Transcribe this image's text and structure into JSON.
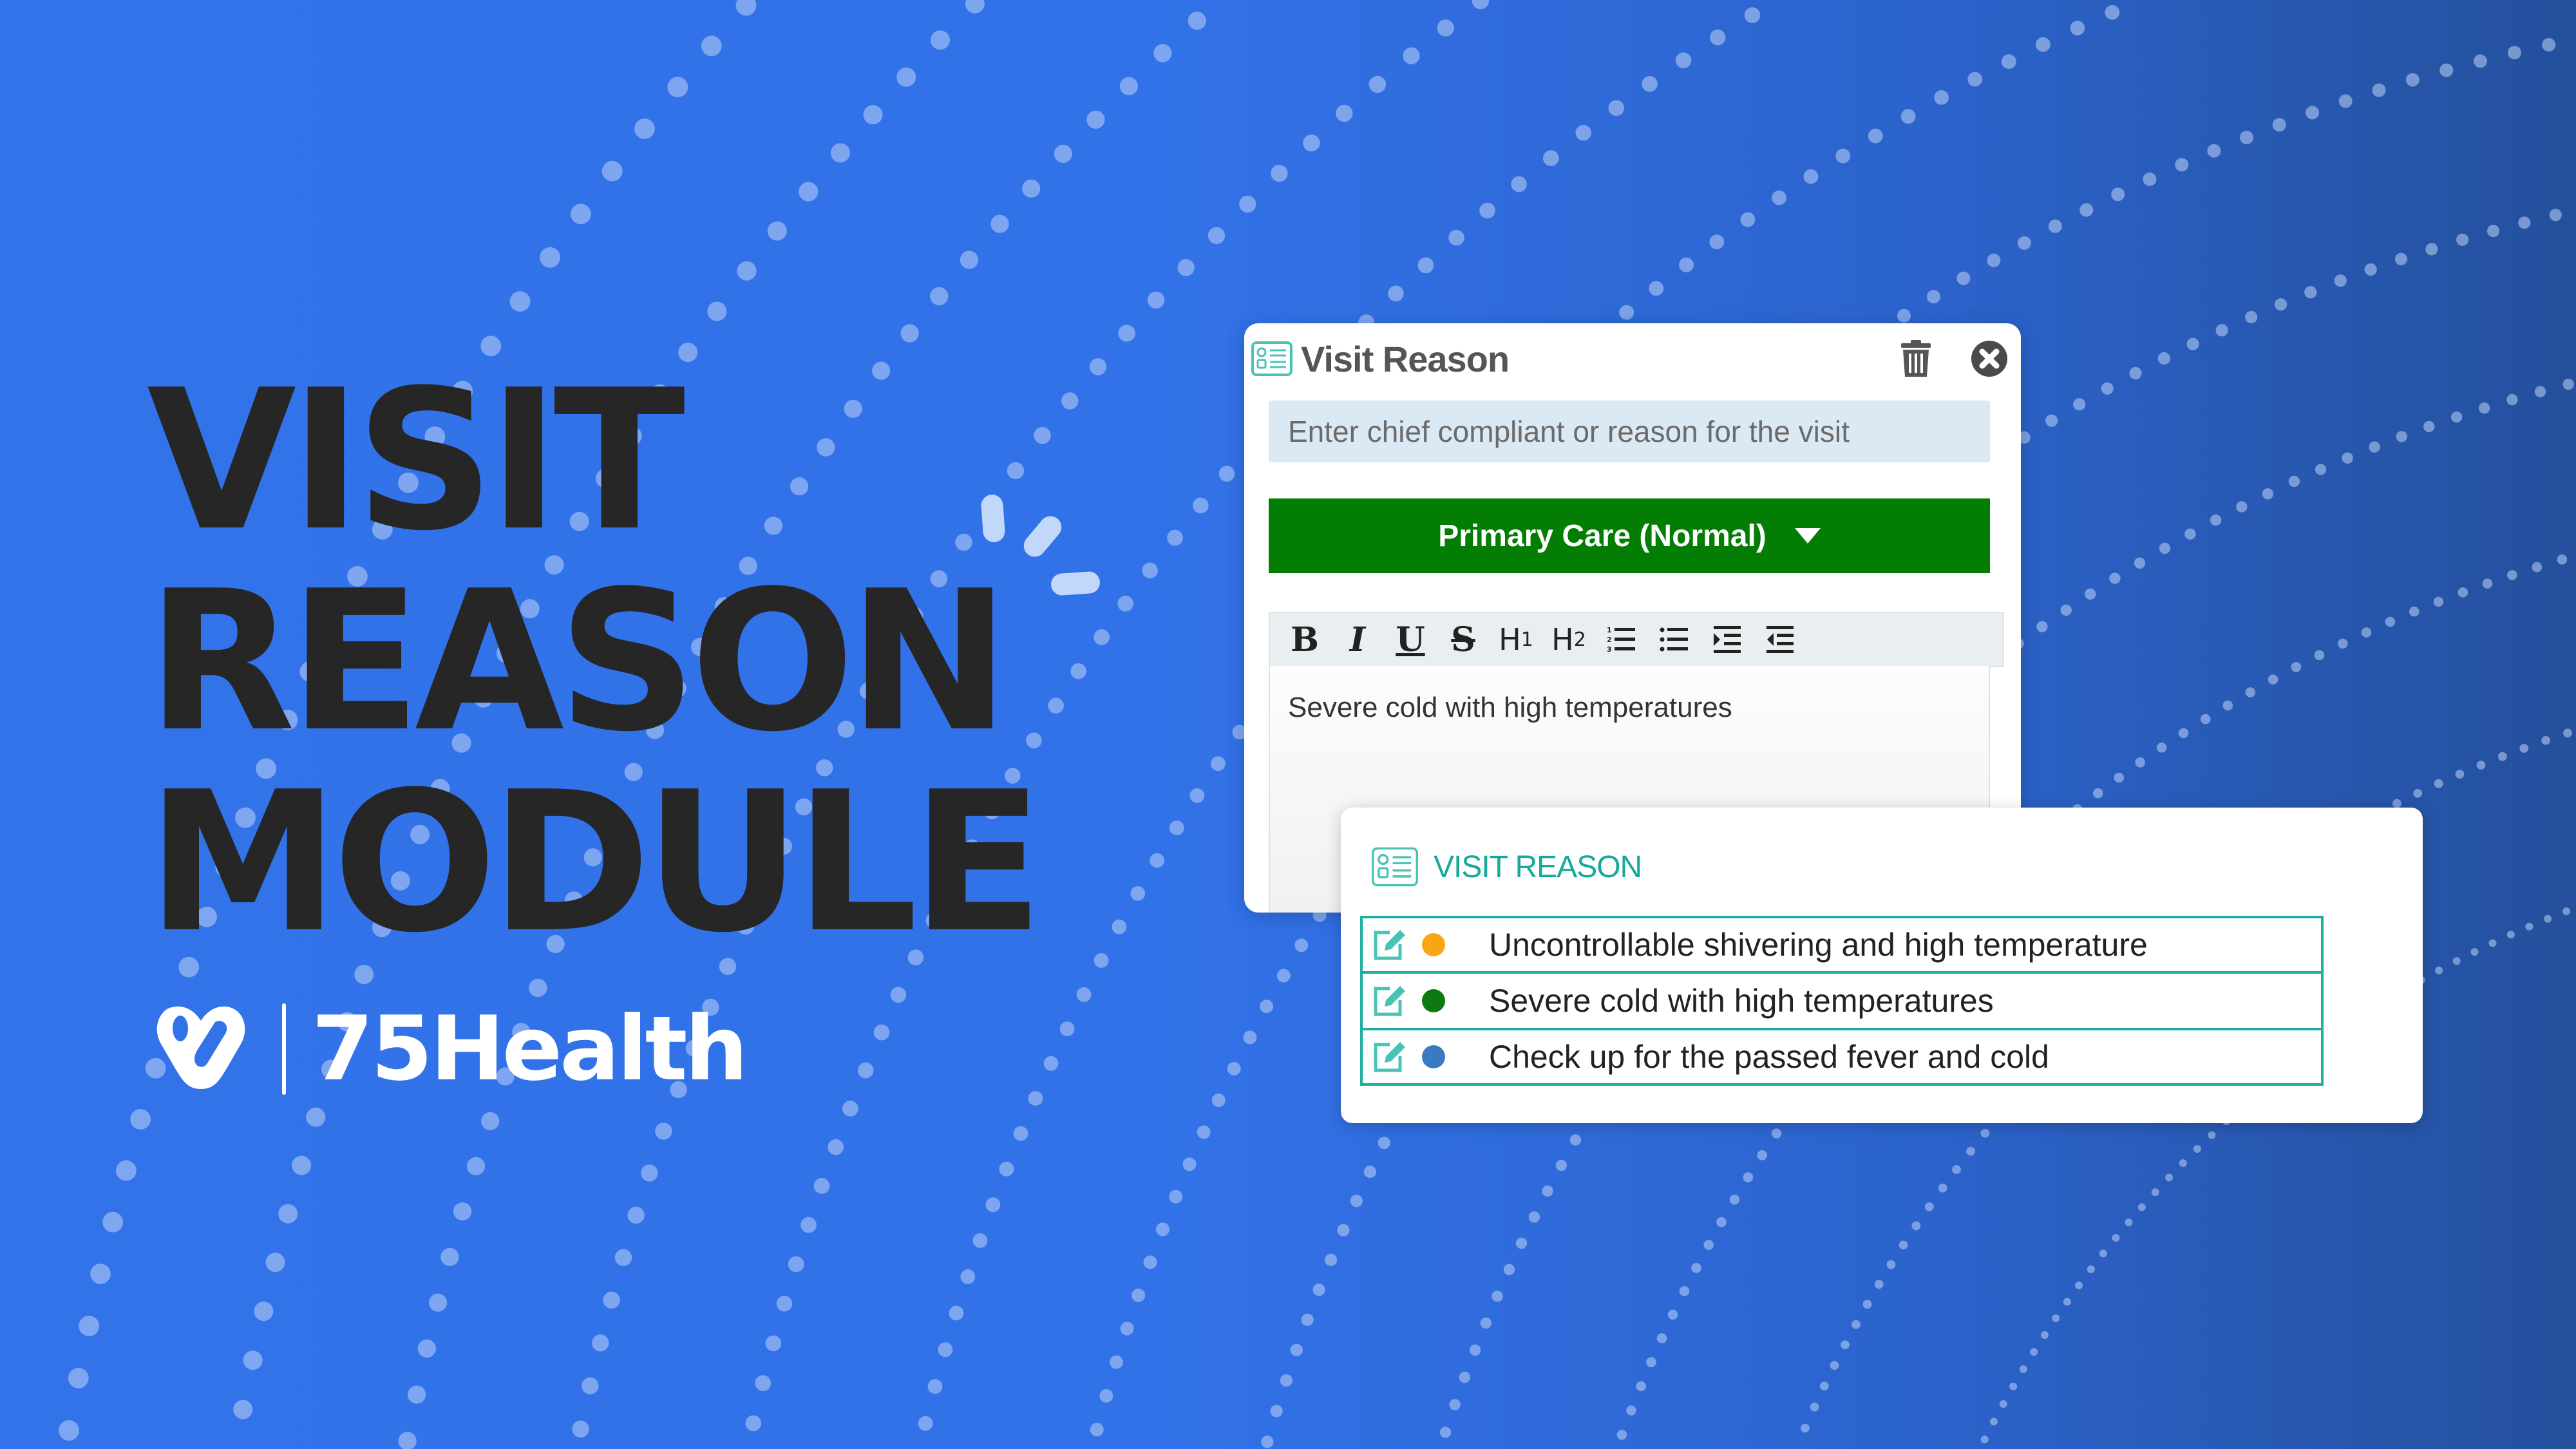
{
  "hero": {
    "lines": [
      "VISIT",
      "REASON",
      "MODULE"
    ]
  },
  "brand": {
    "name": "75Health",
    "logo_icon": "heart-logo-icon"
  },
  "dialog": {
    "title": "Visit Reason",
    "title_icon": "list-form-icon",
    "delete_icon": "trash-icon",
    "close_icon": "close-circle-icon",
    "input": {
      "placeholder": "Enter chief compliant or reason for the visit",
      "value": ""
    },
    "care_select": {
      "selected": "Primary Care (Normal)",
      "color": "#037d03"
    },
    "toolbar": [
      {
        "name": "bold",
        "label": "B"
      },
      {
        "name": "italic",
        "label": "I"
      },
      {
        "name": "underline",
        "label": "U"
      },
      {
        "name": "strikethrough",
        "label": "S"
      },
      {
        "name": "heading-1",
        "label": "H",
        "sub": "1"
      },
      {
        "name": "heading-2",
        "label": "H",
        "sub": "2"
      },
      {
        "name": "ordered-list",
        "icon": "ordered-list-icon"
      },
      {
        "name": "bullet-list",
        "icon": "bullet-list-icon"
      },
      {
        "name": "indent",
        "icon": "indent-icon"
      },
      {
        "name": "outdent",
        "icon": "outdent-icon"
      }
    ],
    "editor_text": "Severe cold with high temperatures"
  },
  "visit_list": {
    "title": "VISIT REASON",
    "accent": "#1fae9f",
    "rows": [
      {
        "text": "Uncontrollable shivering and high temperature",
        "status_color": "#f9a515"
      },
      {
        "text": "Severe cold with high temperatures",
        "status_color": "#0b7a10"
      },
      {
        "text": "Check up for the passed fever and cold",
        "status_color": "#3a7ac0"
      }
    ]
  }
}
